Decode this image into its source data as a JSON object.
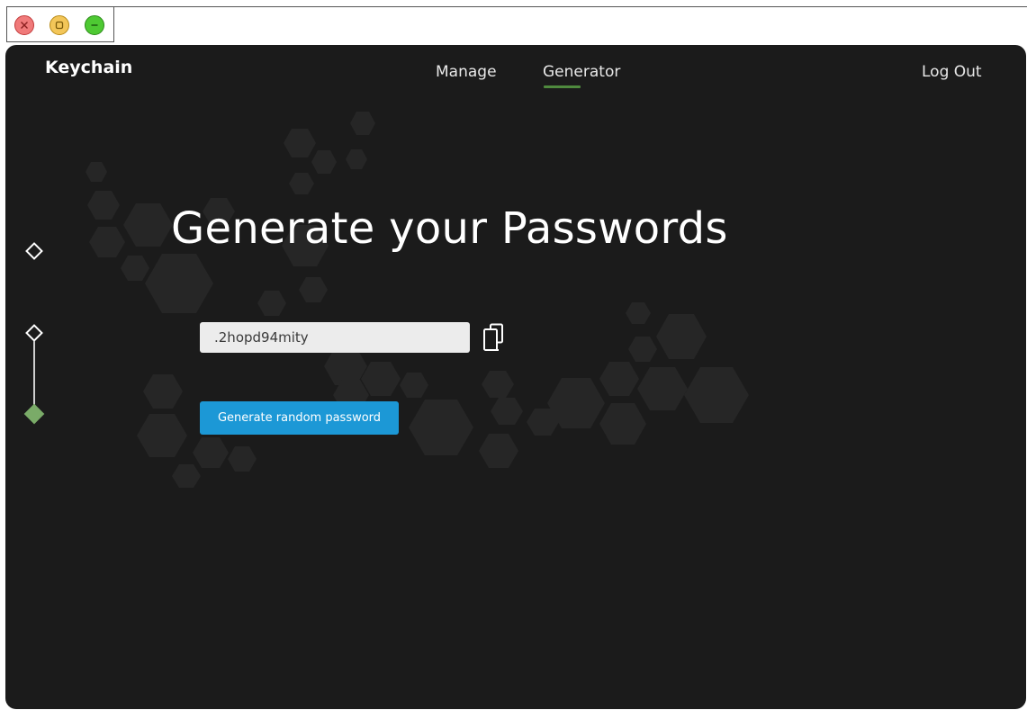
{
  "window": {
    "controls": [
      "close-icon",
      "maximize-icon",
      "minimize-icon"
    ],
    "colors": {
      "close": "#f07a7a",
      "maximize": "#f3c659",
      "minimize": "#4ec933"
    }
  },
  "header": {
    "brand": "Keychain",
    "nav": {
      "manage": "Manage",
      "generator": "Generator"
    },
    "active_tab": "Generator",
    "logout": "Log Out"
  },
  "main": {
    "title": "Generate your Passwords",
    "password_value": ".2hopd94mity",
    "copy_icon": "copy-icon",
    "generate_button": "Generate random password"
  },
  "steps": {
    "count": 3,
    "active": 3
  },
  "colors": {
    "background": "#1b1b1b",
    "accent_green": "#4f8a3e",
    "step_active": "#7aab68",
    "button_blue": "#1c98d6"
  }
}
